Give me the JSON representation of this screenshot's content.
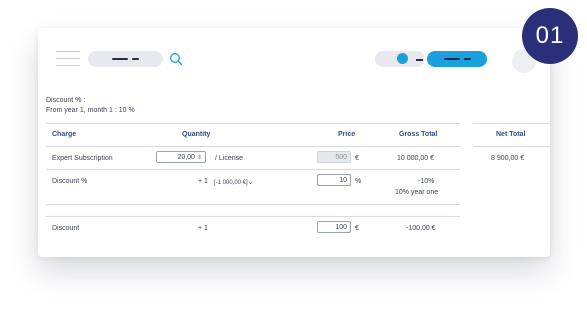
{
  "header": {
    "step_number": "01"
  },
  "summary": {
    "line1": "Discount % :",
    "line2": "From year 1, month 1 : 10 %"
  },
  "table": {
    "headers": {
      "charge": "Charge",
      "quantity": "Quantity",
      "price": "Price",
      "gross_total": "Gross Total",
      "net_total": "Net Total"
    },
    "rows": [
      {
        "charge": "Expert Subscription",
        "quantity_value": "20,00",
        "unit": "/ License",
        "price_value": "500",
        "currency": "€",
        "gross_total": "10 000,00 €",
        "net_total": "8 900,00 €"
      },
      {
        "charge": "Discount %",
        "quantity": "+ 1",
        "scope_select": "[-1 000,00 €]",
        "price_value": "10",
        "unit": "%",
        "gross_total": "-10%",
        "gross_note": "10% year one"
      },
      {
        "charge": "Discount",
        "quantity": "+ 1",
        "price_value": "100",
        "currency": "€",
        "gross_total": "-100,00 €"
      }
    ]
  }
}
